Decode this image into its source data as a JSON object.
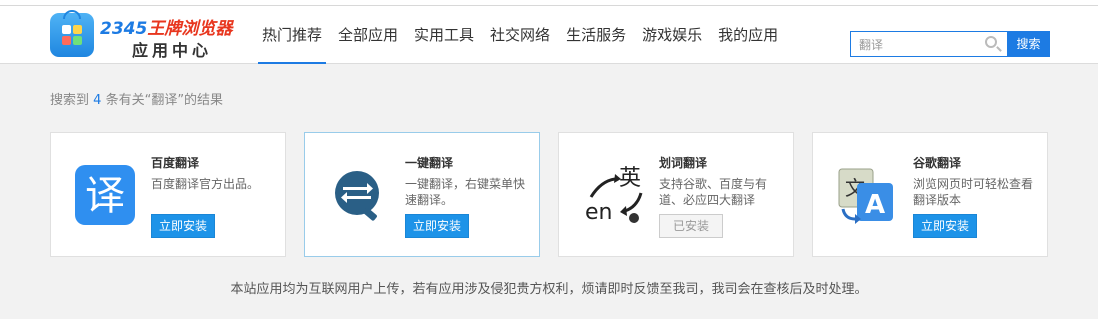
{
  "brand": {
    "name_top_num": "2345",
    "name_top_text": "王牌浏览器",
    "name_bottom": "应用中心",
    "colors": {
      "accent": "#1d7be3",
      "logo_red": "#e8361e"
    }
  },
  "nav": {
    "items": [
      {
        "label": "热门推荐",
        "active": true
      },
      {
        "label": "全部应用"
      },
      {
        "label": "实用工具"
      },
      {
        "label": "社交网络"
      },
      {
        "label": "生活服务"
      },
      {
        "label": "游戏娱乐"
      },
      {
        "label": "我的应用"
      }
    ]
  },
  "search": {
    "value": "翻译",
    "button_label": "搜索",
    "icon": "search-icon"
  },
  "results": {
    "prefix": "搜索到",
    "count": "4",
    "suffix": "条有关“翻译”的结果"
  },
  "apps": [
    {
      "name": "百度翻译",
      "desc": "百度翻译官方出品。",
      "button": "立即安装",
      "icon": "baidu-translate-icon"
    },
    {
      "name": "一键翻译",
      "desc": "一键翻译，右键菜单快速翻译。",
      "button": "立即安装",
      "icon": "one-click-translate-icon"
    },
    {
      "name": "划词翻译",
      "desc": "支持谷歌、百度与有道、必应四大翻译",
      "button": "已安装",
      "icon": "word-select-translate-icon"
    },
    {
      "name": "谷歌翻译",
      "desc": "浏览网页时可轻松查看翻译版本",
      "button": "立即安装",
      "icon": "google-translate-icon"
    }
  ],
  "footer": {
    "text": "本站应用均为互联网用户上传，若有应用涉及侵犯贵方权利，烦请即时反馈至我司，我司会在查核后及时处理。"
  }
}
